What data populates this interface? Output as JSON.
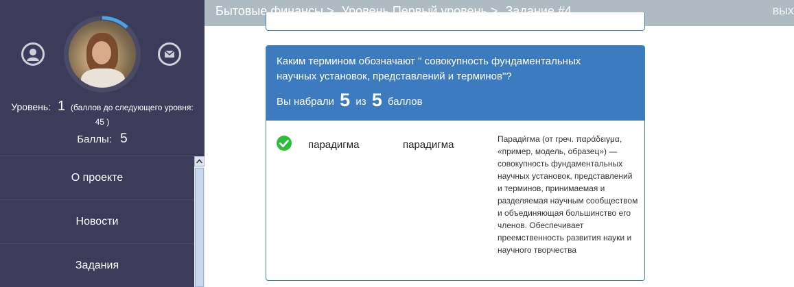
{
  "profile": {
    "level_label": "Уровень:",
    "level_value": "1",
    "level_note": "(баллов до следующего уровня:",
    "level_note_tail": "45 )",
    "points_label": "Баллы:",
    "points_value": "5",
    "icons": {
      "user": "user-icon",
      "mail": "mail-icon"
    }
  },
  "menu": {
    "items": [
      {
        "label": "О проекте"
      },
      {
        "label": "Новости"
      },
      {
        "label": "Задания"
      }
    ]
  },
  "header": {
    "breadcrumb": [
      "Бытовые финансы >",
      "Уровень Первый уровень >",
      "Задание #4"
    ],
    "exit": "ВЫХ"
  },
  "question": {
    "text": "Каким термином обозначают \" совокупность фундаментальных научных установок, представлений и терминов\"?",
    "score_prefix": "Вы набрали",
    "score_value": "5",
    "score_middle": "из",
    "score_max": "5",
    "score_suffix": "баллов"
  },
  "answer": {
    "status": "correct",
    "user_answer": "парадигма",
    "correct_answer": "парадигма",
    "explanation": "Паради́гма (от греч. παράδειγμα, «пример, модель, образец») — совокупность фундаментальных научных установок, представлений и терминов, принимаемая и разделяемая научным сообществом и объединяющая большинство его членов. Обеспечивает преемственность развития науки и научного творчества"
  },
  "colors": {
    "sidebar_bg": "#3c3b5a",
    "header_bg": "#aebbc3",
    "card_header_bg": "#3c7bbf",
    "check_green": "#2dbd3a"
  }
}
